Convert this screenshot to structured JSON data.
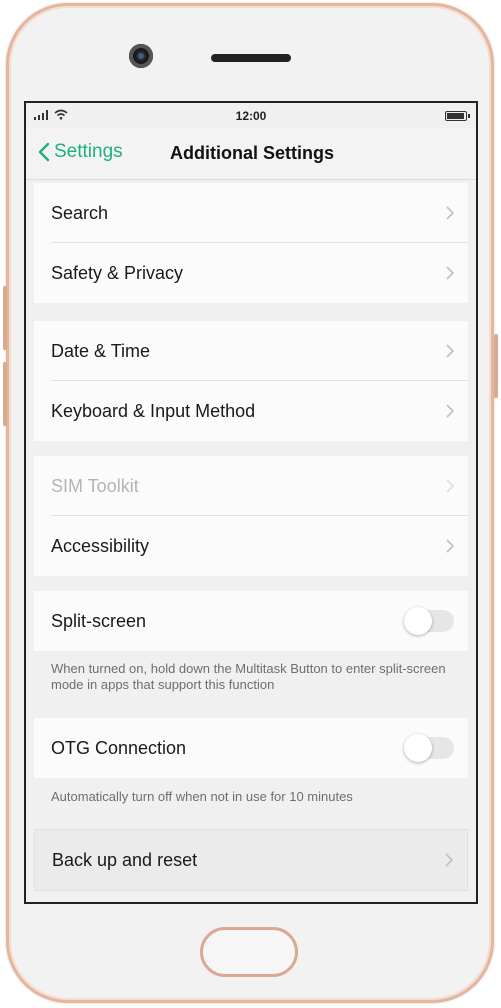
{
  "status": {
    "time": "12:00"
  },
  "nav": {
    "back_label": "Settings",
    "title": "Additional Settings"
  },
  "groups": {
    "g1": [
      "Search",
      "Safety & Privacy"
    ],
    "g2": [
      "Date & Time",
      "Keyboard & Input Method"
    ],
    "g3": [
      "SIM Toolkit",
      "Accessibility"
    ],
    "split": {
      "label": "Split-screen",
      "on": false,
      "hint": "When turned on, hold down the Multitask Button to enter split-screen mode in apps that support this function"
    },
    "otg": {
      "label": "OTG Connection",
      "on": false,
      "hint": "Automatically turn off when not in use for 10 minutes"
    },
    "reset": "Back up and reset"
  },
  "colors": {
    "accent": "#1fb07f",
    "frame": "#e2b7a0"
  }
}
